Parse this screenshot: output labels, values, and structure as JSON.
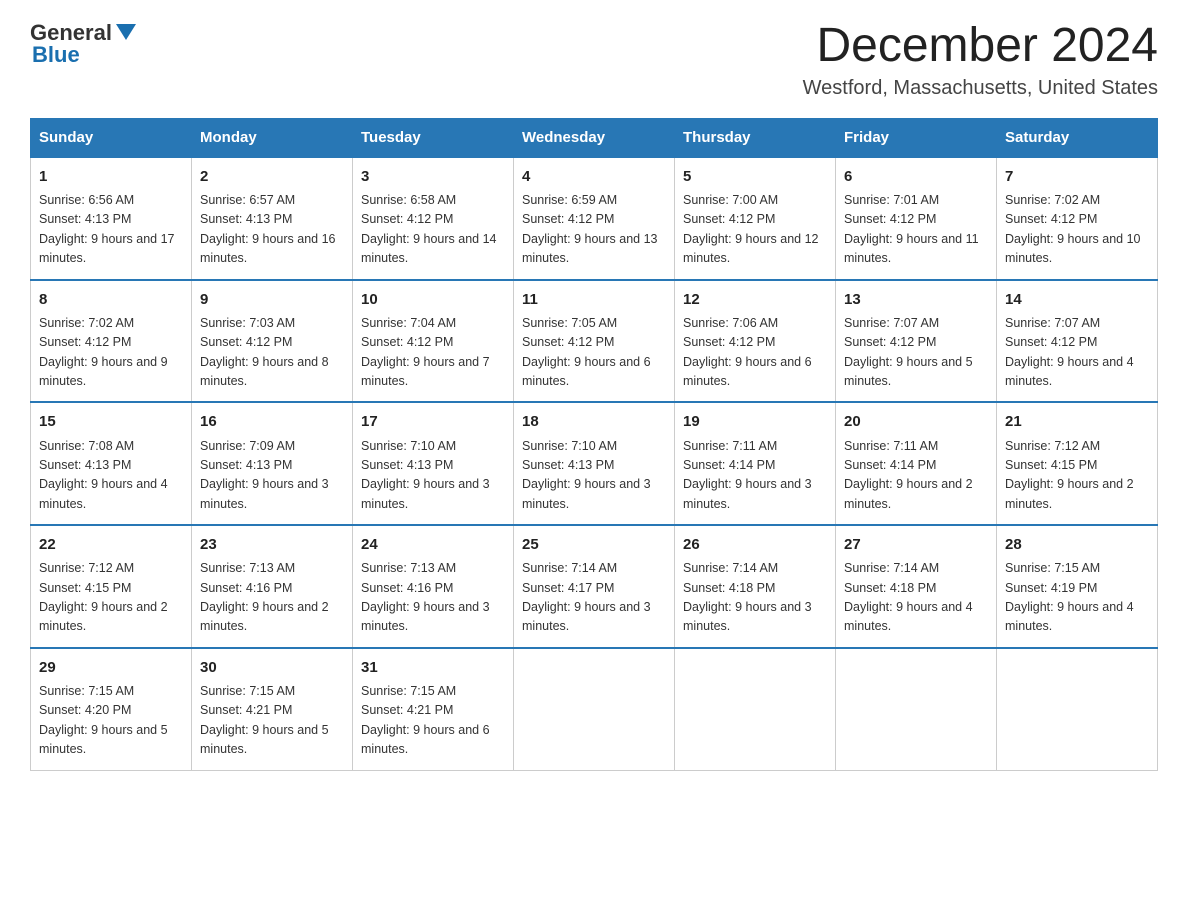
{
  "logo": {
    "general": "General",
    "blue": "Blue"
  },
  "title": "December 2024",
  "location": "Westford, Massachusetts, United States",
  "days_of_week": [
    "Sunday",
    "Monday",
    "Tuesday",
    "Wednesday",
    "Thursday",
    "Friday",
    "Saturday"
  ],
  "weeks": [
    [
      {
        "day": "1",
        "sunrise": "6:56 AM",
        "sunset": "4:13 PM",
        "daylight": "9 hours and 17 minutes."
      },
      {
        "day": "2",
        "sunrise": "6:57 AM",
        "sunset": "4:13 PM",
        "daylight": "9 hours and 16 minutes."
      },
      {
        "day": "3",
        "sunrise": "6:58 AM",
        "sunset": "4:12 PM",
        "daylight": "9 hours and 14 minutes."
      },
      {
        "day": "4",
        "sunrise": "6:59 AM",
        "sunset": "4:12 PM",
        "daylight": "9 hours and 13 minutes."
      },
      {
        "day": "5",
        "sunrise": "7:00 AM",
        "sunset": "4:12 PM",
        "daylight": "9 hours and 12 minutes."
      },
      {
        "day": "6",
        "sunrise": "7:01 AM",
        "sunset": "4:12 PM",
        "daylight": "9 hours and 11 minutes."
      },
      {
        "day": "7",
        "sunrise": "7:02 AM",
        "sunset": "4:12 PM",
        "daylight": "9 hours and 10 minutes."
      }
    ],
    [
      {
        "day": "8",
        "sunrise": "7:02 AM",
        "sunset": "4:12 PM",
        "daylight": "9 hours and 9 minutes."
      },
      {
        "day": "9",
        "sunrise": "7:03 AM",
        "sunset": "4:12 PM",
        "daylight": "9 hours and 8 minutes."
      },
      {
        "day": "10",
        "sunrise": "7:04 AM",
        "sunset": "4:12 PM",
        "daylight": "9 hours and 7 minutes."
      },
      {
        "day": "11",
        "sunrise": "7:05 AM",
        "sunset": "4:12 PM",
        "daylight": "9 hours and 6 minutes."
      },
      {
        "day": "12",
        "sunrise": "7:06 AM",
        "sunset": "4:12 PM",
        "daylight": "9 hours and 6 minutes."
      },
      {
        "day": "13",
        "sunrise": "7:07 AM",
        "sunset": "4:12 PM",
        "daylight": "9 hours and 5 minutes."
      },
      {
        "day": "14",
        "sunrise": "7:07 AM",
        "sunset": "4:12 PM",
        "daylight": "9 hours and 4 minutes."
      }
    ],
    [
      {
        "day": "15",
        "sunrise": "7:08 AM",
        "sunset": "4:13 PM",
        "daylight": "9 hours and 4 minutes."
      },
      {
        "day": "16",
        "sunrise": "7:09 AM",
        "sunset": "4:13 PM",
        "daylight": "9 hours and 3 minutes."
      },
      {
        "day": "17",
        "sunrise": "7:10 AM",
        "sunset": "4:13 PM",
        "daylight": "9 hours and 3 minutes."
      },
      {
        "day": "18",
        "sunrise": "7:10 AM",
        "sunset": "4:13 PM",
        "daylight": "9 hours and 3 minutes."
      },
      {
        "day": "19",
        "sunrise": "7:11 AM",
        "sunset": "4:14 PM",
        "daylight": "9 hours and 3 minutes."
      },
      {
        "day": "20",
        "sunrise": "7:11 AM",
        "sunset": "4:14 PM",
        "daylight": "9 hours and 2 minutes."
      },
      {
        "day": "21",
        "sunrise": "7:12 AM",
        "sunset": "4:15 PM",
        "daylight": "9 hours and 2 minutes."
      }
    ],
    [
      {
        "day": "22",
        "sunrise": "7:12 AM",
        "sunset": "4:15 PM",
        "daylight": "9 hours and 2 minutes."
      },
      {
        "day": "23",
        "sunrise": "7:13 AM",
        "sunset": "4:16 PM",
        "daylight": "9 hours and 2 minutes."
      },
      {
        "day": "24",
        "sunrise": "7:13 AM",
        "sunset": "4:16 PM",
        "daylight": "9 hours and 3 minutes."
      },
      {
        "day": "25",
        "sunrise": "7:14 AM",
        "sunset": "4:17 PM",
        "daylight": "9 hours and 3 minutes."
      },
      {
        "day": "26",
        "sunrise": "7:14 AM",
        "sunset": "4:18 PM",
        "daylight": "9 hours and 3 minutes."
      },
      {
        "day": "27",
        "sunrise": "7:14 AM",
        "sunset": "4:18 PM",
        "daylight": "9 hours and 4 minutes."
      },
      {
        "day": "28",
        "sunrise": "7:15 AM",
        "sunset": "4:19 PM",
        "daylight": "9 hours and 4 minutes."
      }
    ],
    [
      {
        "day": "29",
        "sunrise": "7:15 AM",
        "sunset": "4:20 PM",
        "daylight": "9 hours and 5 minutes."
      },
      {
        "day": "30",
        "sunrise": "7:15 AM",
        "sunset": "4:21 PM",
        "daylight": "9 hours and 5 minutes."
      },
      {
        "day": "31",
        "sunrise": "7:15 AM",
        "sunset": "4:21 PM",
        "daylight": "9 hours and 6 minutes."
      },
      null,
      null,
      null,
      null
    ]
  ]
}
